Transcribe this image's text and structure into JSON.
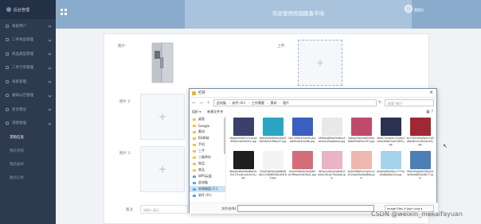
{
  "header": {
    "title": "欢迎使用校园跳蚤市场",
    "user_name": "管理员",
    "menu_icon": "grid-icon"
  },
  "sidebar": {
    "logo": "后台管理",
    "items": [
      {
        "label": "系统用户",
        "icon": "user-icon"
      },
      {
        "label": "二手商品管理",
        "icon": "goods-icon"
      },
      {
        "label": "商品类型管理",
        "icon": "type-icon"
      },
      {
        "label": "二手订单管理",
        "icon": "order-icon"
      },
      {
        "label": "系统管理",
        "icon": "gear-icon"
      },
      {
        "label": "通知公告管理",
        "icon": "notice-icon"
      },
      {
        "label": "投诉建议",
        "icon": "complaint-icon"
      },
      {
        "label": "求购管理",
        "icon": "request-icon"
      }
    ],
    "subitems": [
      {
        "label": "求购信息",
        "active": true
      },
      {
        "label": "我的求购",
        "active": false
      },
      {
        "label": "我的发布",
        "active": false
      },
      {
        "label": "我的订单",
        "active": false
      }
    ]
  },
  "form": {
    "main_image_label": "图片:",
    "upload_label": "上传:",
    "image2_label": "图片 2",
    "image3_label": "图片 3",
    "remark_label": "备注",
    "remark_placeholder": "请输入备注"
  },
  "dialog": {
    "title": "打开",
    "close": "×",
    "path": [
      "此电脑",
      "软件 (H:)",
      "工作需要",
      "素材",
      "图片"
    ],
    "search_placeholder": "搜索\"图片\"",
    "toolbar": [
      "组织 ▾",
      "新建文件夹"
    ],
    "tree": [
      {
        "label": "桌面",
        "kind": "folder"
      },
      {
        "label": "Google",
        "kind": "folder"
      },
      {
        "label": "素材",
        "kind": "folder"
      },
      {
        "label": "B2商城",
        "kind": "folder"
      },
      {
        "label": "手机",
        "kind": "folder"
      },
      {
        "label": "三手",
        "kind": "folder"
      },
      {
        "label": "三级库存",
        "kind": "folder"
      },
      {
        "label": "商品",
        "kind": "folder"
      },
      {
        "label": "商品",
        "kind": "folder"
      },
      {
        "label": "WPS云盘",
        "kind": "cloud"
      },
      {
        "label": "此电脑",
        "kind": "pc"
      },
      {
        "label": "本地磁盘 (C:)",
        "kind": "pc",
        "selected": true
      },
      {
        "label": "软件 (H:)",
        "kind": "pc"
      }
    ],
    "files": [
      {
        "name": "0bdeac650fc27cacb4999efc4a5ed20c.jpg",
        "color": "#3a3f6b"
      },
      {
        "name": "0eeb5a9e80aa54ae5fbc56d14df8ca47.jpg",
        "color": "#2aa6c4"
      },
      {
        "name": "2b274f9b43d1d5c4ccb6d04af4ca26b.jpg",
        "color": "#3b5fbf"
      },
      {
        "name": "2f9fe0a8f0e05e6bcdae4a1d5aa8dcaa.jpg",
        "color": "#e8e8e8"
      },
      {
        "name": "3b6ad7fb5e58049ea6db0ff3a83a13f1.jpg",
        "color": "#c04a6a"
      },
      {
        "name": "3b6d71e4d4c1220bcf1b4e4fa6e1a4c2893.jpg",
        "color": "#2b3150"
      },
      {
        "name": "5a77633f0fd5e2c7b5dbe4b1c1d0c2ec54.jpg",
        "color": "#a02734"
      },
      {
        "name": "6be4b08b0b6d8be5c3c21f1ad1ca4cfa7a.jpg",
        "color": "#1f1f1f"
      },
      {
        "name": "7e0d24b5b2e8d8f38b0c1c58d6458cd4f163.jpg",
        "color": "#f4f4f4"
      },
      {
        "name": "9a4c9f0fb3b3b4f4b5bc9f6aa3c8c0b41.jpg",
        "color": "#d46d7a"
      },
      {
        "name": "9b3a1e4b5a5d8a61fe0ea19cdc7fa4dab.jpg",
        "color": "#e9b3c8"
      },
      {
        "name": "9d0d3f68f1a7aa2cc3251bd4b5ad0d8ab.jpg",
        "color": "#f0b6b0"
      },
      {
        "name": "9e4b5d8d2f6cc7773ab0d8ca8a41d.jpg",
        "color": "#a5d3ea"
      },
      {
        "name": "9f5e50a8dd03d9a2d4e9a9d8f3a26b77.jpg",
        "color": "#4c7fb6"
      }
    ],
    "filename_label": "文件名(N):",
    "filetype": "Image Files (*.jpg;*.png ▾"
  },
  "watermark": "CSDN @weixin_mekaifayuan",
  "colors": {
    "sidebar_bg": "#2e3a4f",
    "header_bg": "#8aaccc",
    "header_center_bg": "#a9c3dc"
  }
}
